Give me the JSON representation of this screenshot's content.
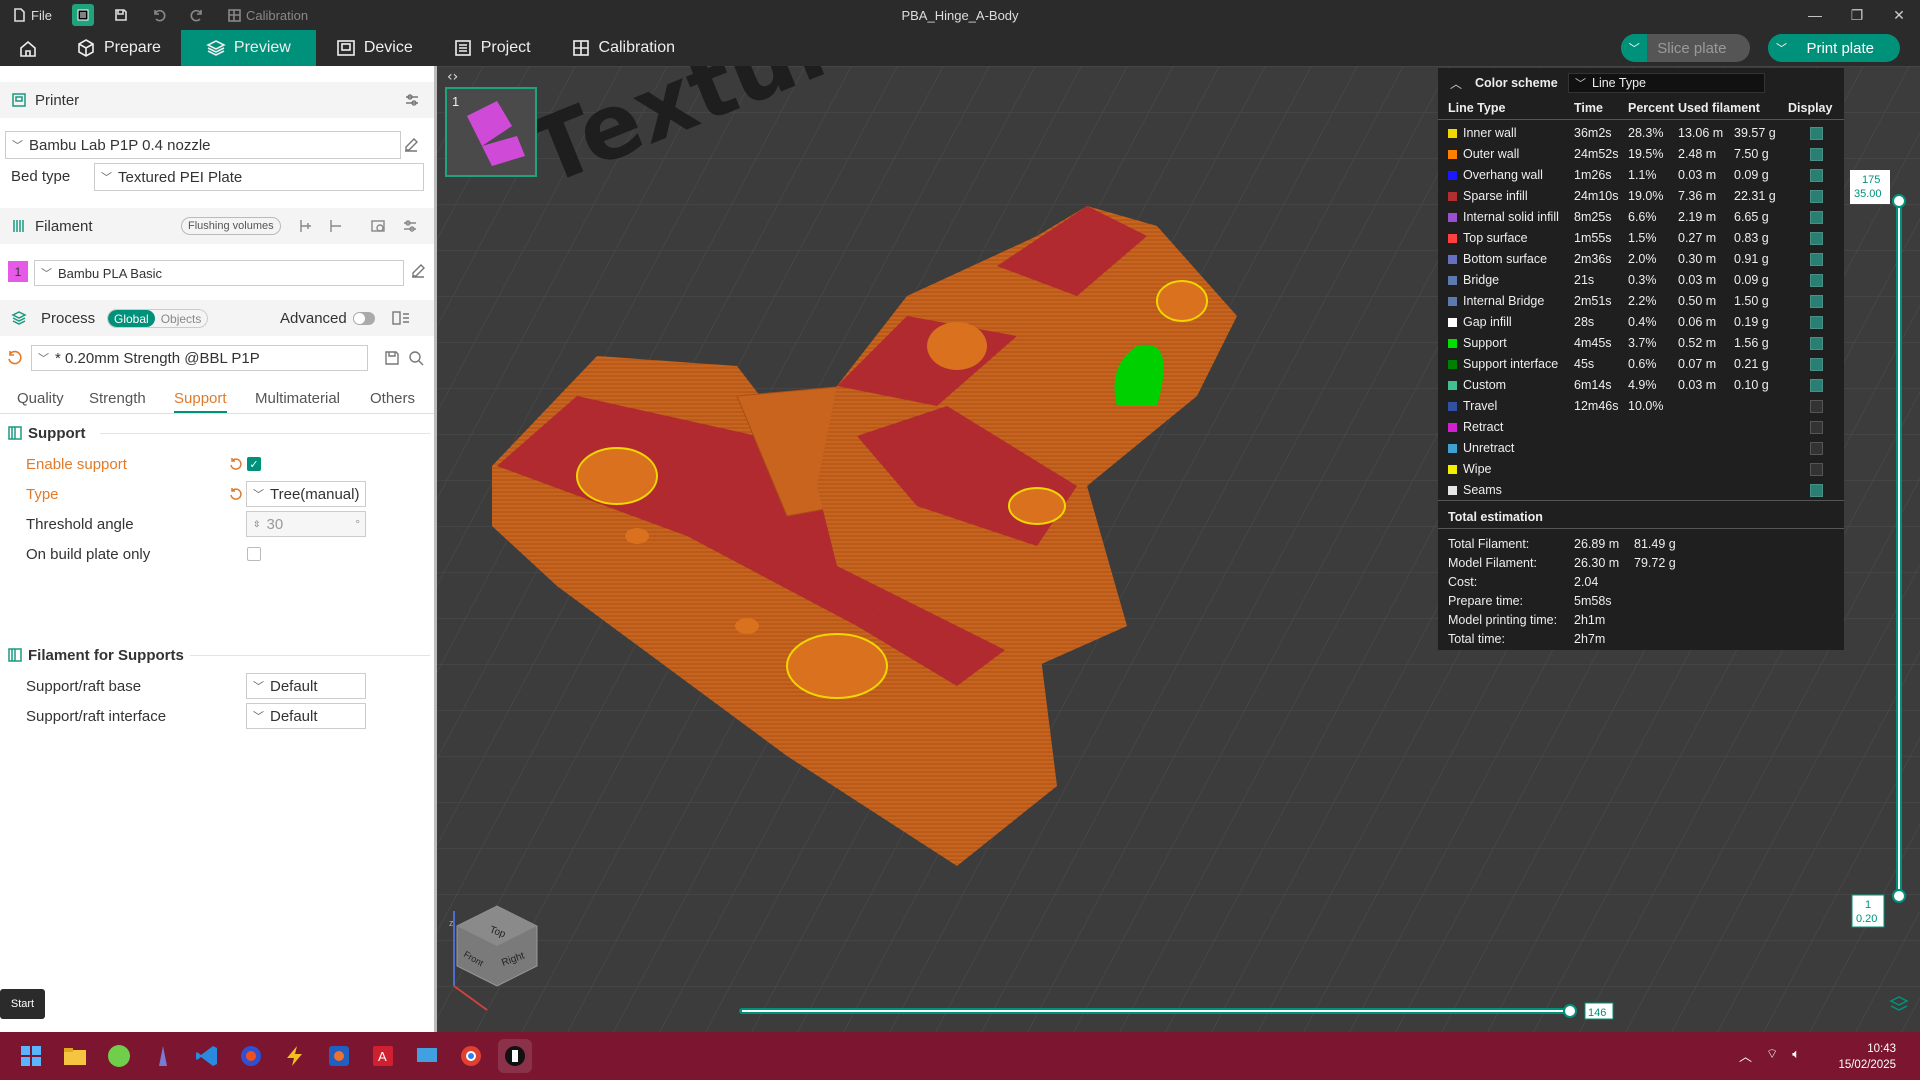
{
  "titlebar": {
    "file_label": "File",
    "calibration_label": "Calibration",
    "window_title": "PBA_Hinge_A-Body"
  },
  "nav": {
    "prepare": "Prepare",
    "preview": "Preview",
    "device": "Device",
    "project": "Project",
    "calibration": "Calibration",
    "slice_plate": "Slice plate",
    "print_plate": "Print plate"
  },
  "sidebar": {
    "printer_title": "Printer",
    "printer_name": "Bambu Lab P1P 0.4 nozzle",
    "bed_type_label": "Bed type",
    "bed_type_value": "Textured PEI Plate",
    "filament_title": "Filament",
    "flushing_volumes": "Flushing volumes",
    "filament_index": "1",
    "filament_name": "Bambu PLA Basic",
    "process_title": "Process",
    "global_label": "Global",
    "objects_label": "Objects",
    "advanced_label": "Advanced",
    "process_preset": "* 0.20mm Strength @BBL P1P",
    "tabs": [
      "Quality",
      "Strength",
      "Support",
      "Multimaterial",
      "Others"
    ],
    "support_section": "Support",
    "enable_support": "Enable support",
    "type_label": "Type",
    "type_value": "Tree(manual)",
    "threshold_angle": "Threshold angle",
    "threshold_value": "30",
    "threshold_unit": "°",
    "on_build_plate": "On build plate only",
    "filament_for_supports": "Filament for Supports",
    "support_raft_base": "Support/raft base",
    "support_raft_base_value": "Default",
    "support_raft_interface": "Support/raft interface",
    "support_raft_interface_value": "Default",
    "start_tooltip": "Start"
  },
  "viewport": {
    "plate_number": "1",
    "bed_text": "Textured",
    "layer_top": "175",
    "layer_top_height": "35.00",
    "layer_bottom": "1",
    "layer_bottom_height": "0.20",
    "moves_value": "146",
    "cube_top": "Top",
    "cube_front": "Front",
    "cube_right": "Right",
    "axis_z": "z"
  },
  "legend": {
    "title": "Color scheme",
    "scheme": "Line Type",
    "headers": [
      "Line Type",
      "Time",
      "Percent",
      "Used filament",
      "Display"
    ],
    "rows": [
      {
        "name": "Inner wall",
        "color": "#f2d600",
        "time": "36m2s",
        "pct": "28.3%",
        "len": "13.06 m",
        "g": "39.57 g",
        "on": true
      },
      {
        "name": "Outer wall",
        "color": "#ff7f00",
        "time": "24m52s",
        "pct": "19.5%",
        "len": "2.48 m",
        "g": "7.50 g",
        "on": true
      },
      {
        "name": "Overhang wall",
        "color": "#1a1aff",
        "time": "1m26s",
        "pct": "1.1%",
        "len": "0.03 m",
        "g": "0.09 g",
        "on": true
      },
      {
        "name": "Sparse infill",
        "color": "#b03030",
        "time": "24m10s",
        "pct": "19.0%",
        "len": "7.36 m",
        "g": "22.31 g",
        "on": true
      },
      {
        "name": "Internal solid infill",
        "color": "#9a4fd0",
        "time": "8m25s",
        "pct": "6.6%",
        "len": "2.19 m",
        "g": "6.65 g",
        "on": true
      },
      {
        "name": "Top surface",
        "color": "#ff4040",
        "time": "1m55s",
        "pct": "1.5%",
        "len": "0.27 m",
        "g": "0.83 g",
        "on": true
      },
      {
        "name": "Bottom surface",
        "color": "#6670c0",
        "time": "2m36s",
        "pct": "2.0%",
        "len": "0.30 m",
        "g": "0.91 g",
        "on": true
      },
      {
        "name": "Bridge",
        "color": "#5a7ab0",
        "time": "21s",
        "pct": "0.3%",
        "len": "0.03 m",
        "g": "0.09 g",
        "on": true
      },
      {
        "name": "Internal Bridge",
        "color": "#5a7ab0",
        "time": "2m51s",
        "pct": "2.2%",
        "len": "0.50 m",
        "g": "1.50 g",
        "on": true
      },
      {
        "name": "Gap infill",
        "color": "#ffffff",
        "time": "28s",
        "pct": "0.4%",
        "len": "0.06 m",
        "g": "0.19 g",
        "on": true
      },
      {
        "name": "Support",
        "color": "#00e000",
        "time": "4m45s",
        "pct": "3.7%",
        "len": "0.52 m",
        "g": "1.56 g",
        "on": true
      },
      {
        "name": "Support interface",
        "color": "#008000",
        "time": "45s",
        "pct": "0.6%",
        "len": "0.07 m",
        "g": "0.21 g",
        "on": true
      },
      {
        "name": "Custom",
        "color": "#40c090",
        "time": "6m14s",
        "pct": "4.9%",
        "len": "0.03 m",
        "g": "0.10 g",
        "on": true
      },
      {
        "name": "Travel",
        "color": "#3050a0",
        "time": "12m46s",
        "pct": "10.0%",
        "len": "",
        "g": "",
        "on": false
      },
      {
        "name": "Retract",
        "color": "#d020d0",
        "time": "",
        "pct": "",
        "len": "",
        "g": "",
        "on": false
      },
      {
        "name": "Unretract",
        "color": "#40a0d0",
        "time": "",
        "pct": "",
        "len": "",
        "g": "",
        "on": false
      },
      {
        "name": "Wipe",
        "color": "#f0f000",
        "time": "",
        "pct": "",
        "len": "",
        "g": "",
        "on": false
      },
      {
        "name": "Seams",
        "color": "#e6e6e6",
        "time": "",
        "pct": "",
        "len": "",
        "g": "",
        "on": true
      }
    ],
    "total_title": "Total estimation",
    "totals": [
      {
        "label": "Total Filament:",
        "v1": "26.89 m",
        "v2": "81.49 g"
      },
      {
        "label": "Model Filament:",
        "v1": "26.30 m",
        "v2": "79.72 g"
      },
      {
        "label": "Cost:",
        "v1": "2.04",
        "v2": ""
      },
      {
        "label": "Prepare time:",
        "v1": "5m58s",
        "v2": ""
      },
      {
        "label": "Model printing time:",
        "v1": "2h1m",
        "v2": ""
      },
      {
        "label": "Total time:",
        "v1": "2h7m",
        "v2": ""
      }
    ]
  },
  "taskbar": {
    "time": "10:43",
    "date": "15/02/2025"
  },
  "colors": {
    "accent": "#00917a",
    "orange_text": "#e07b2b",
    "model_orange": "#c8641e",
    "model_red": "#b02a30"
  }
}
